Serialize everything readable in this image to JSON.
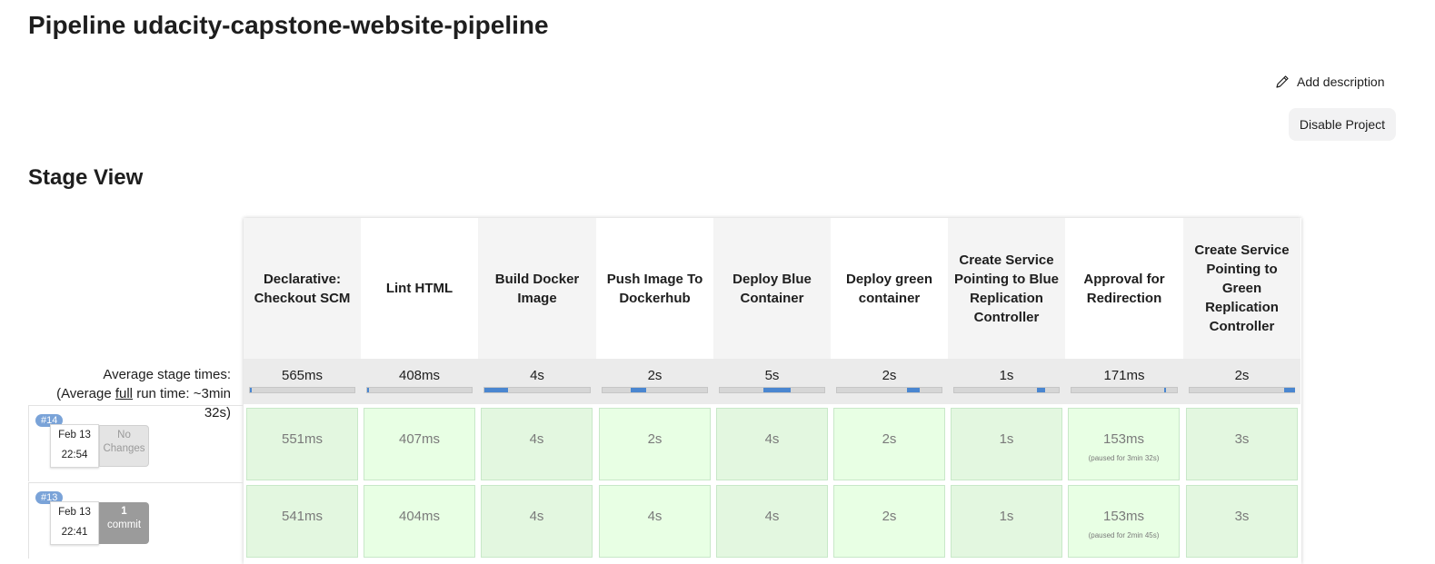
{
  "page": {
    "title": "Pipeline udacity-capstone-website-pipeline",
    "add_description": "Add description",
    "disable_project": "Disable Project",
    "stage_view_title": "Stage View"
  },
  "summary": {
    "avg_stage_label": "Average stage times:",
    "avg_full_prefix": "(Average ",
    "avg_full_link": "full",
    "avg_full_suffix": " run time: ~3min 32s)"
  },
  "stages": [
    {
      "name": "Declarative: Checkout SCM",
      "avg": "565ms",
      "avg_fraction": 0.02
    },
    {
      "name": "Lint HTML",
      "avg": "408ms",
      "avg_fraction": 0.02
    },
    {
      "name": "Build Docker Image",
      "avg": "4s",
      "avg_fraction": 0.22
    },
    {
      "name": "Push Image To Dockerhub",
      "avg": "2s",
      "avg_fraction": 0.15
    },
    {
      "name": "Deploy Blue Container",
      "avg": "5s",
      "avg_fraction": 0.26
    },
    {
      "name": "Deploy green container",
      "avg": "2s",
      "avg_fraction": 0.12
    },
    {
      "name": "Create Service Pointing to Blue Replication Controller",
      "avg": "1s",
      "avg_fraction": 0.08
    },
    {
      "name": "Approval for Redirection",
      "avg": "171ms",
      "avg_fraction": 0.01
    },
    {
      "name": "Create Service Pointing to Green Replication Controller",
      "avg": "2s",
      "avg_fraction": 0.1
    }
  ],
  "runs": [
    {
      "id": "#14",
      "date": "Feb 13",
      "time": "22:54",
      "changes_line1": "No",
      "changes_line2": "Changes",
      "has_commit": false,
      "durations": [
        "551ms",
        "407ms",
        "4s",
        "2s",
        "4s",
        "2s",
        "1s",
        "153ms",
        "3s"
      ],
      "paused": [
        "",
        "",
        "",
        "",
        "",
        "",
        "",
        "(paused for 3min 32s)",
        ""
      ]
    },
    {
      "id": "#13",
      "date": "Feb 13",
      "time": "22:41",
      "changes_line1": "1",
      "changes_line2": "commit",
      "has_commit": true,
      "durations": [
        "541ms",
        "404ms",
        "4s",
        "4s",
        "4s",
        "2s",
        "1s",
        "153ms",
        "3s"
      ],
      "paused": [
        "",
        "",
        "",
        "",
        "",
        "",
        "",
        "(paused for 2min 45s)",
        ""
      ]
    }
  ],
  "colors": {
    "success_cell": "#e3f7e0",
    "success_cell_alt": "#e8ffe4",
    "progress_fill": "#4a86d0",
    "build_badge": "#7aa3d8"
  }
}
